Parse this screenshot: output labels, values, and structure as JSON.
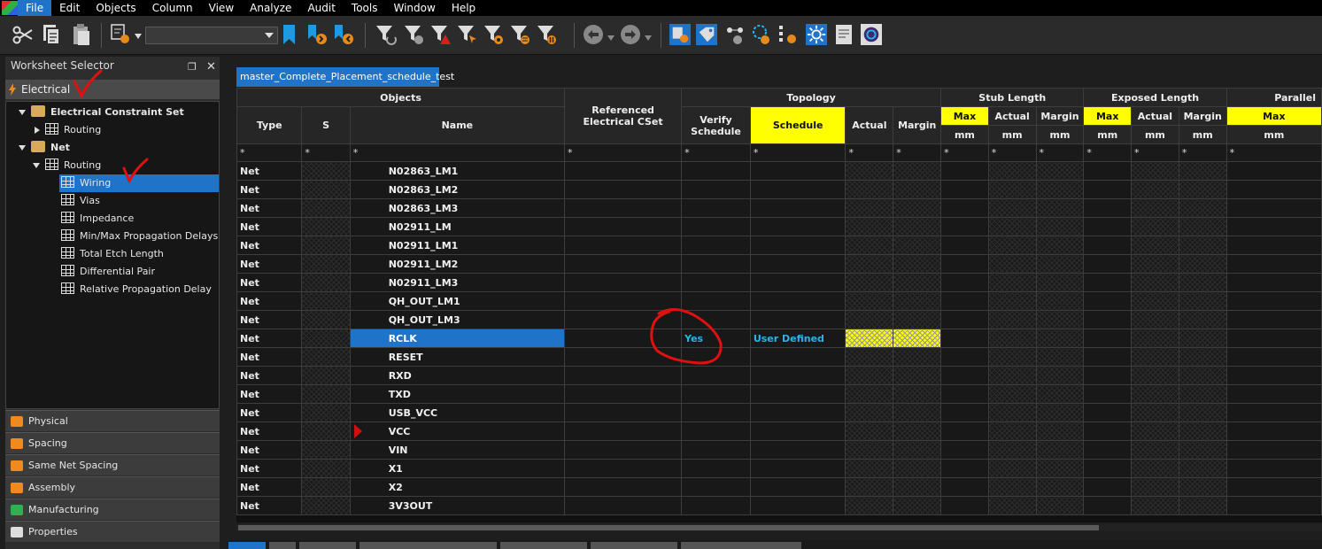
{
  "menubar": {
    "items": [
      "File",
      "Edit",
      "Objects",
      "Column",
      "View",
      "Analyze",
      "Audit",
      "Tools",
      "Window",
      "Help"
    ],
    "active_index": 0
  },
  "toolbar": {
    "combo_value": "",
    "icons": [
      "cut-icon",
      "copy-icon",
      "paste-icon",
      "find-icon",
      "bookmark-icon",
      "bookmark-next-icon",
      "bookmark-prev-icon",
      "filter-icon",
      "filter-clear-icon",
      "filter-error-icon",
      "filter-select-icon",
      "filter-settings-icon",
      "filter-list-icon",
      "filter-pause-icon",
      "undo-icon",
      "redo-icon",
      "sheet-icon",
      "tag-icon",
      "net-icon",
      "loop-icon",
      "group-icon",
      "settings-sun-icon",
      "report-icon",
      "search-icon"
    ]
  },
  "worksheet_selector": {
    "title": "Worksheet Selector",
    "category": "Electrical",
    "tree": [
      {
        "label": "Electrical Constraint Set",
        "level": 0,
        "kind": "folder",
        "expanded": true
      },
      {
        "label": "Routing",
        "level": 1,
        "kind": "sheet",
        "expanded": false
      },
      {
        "label": "Net",
        "level": 0,
        "kind": "folder",
        "expanded": true
      },
      {
        "label": "Routing",
        "level": 1,
        "kind": "sheet",
        "expanded": true
      },
      {
        "label": "Wiring",
        "level": 2,
        "kind": "sheet",
        "selected": true
      },
      {
        "label": "Vias",
        "level": 2,
        "kind": "sheet"
      },
      {
        "label": "Impedance",
        "level": 2,
        "kind": "sheet"
      },
      {
        "label": "Min/Max Propagation Delays",
        "level": 2,
        "kind": "sheet"
      },
      {
        "label": "Total Etch Length",
        "level": 2,
        "kind": "sheet"
      },
      {
        "label": "Differential Pair",
        "level": 2,
        "kind": "sheet"
      },
      {
        "label": "Relative Propagation Delay",
        "level": 2,
        "kind": "sheet"
      }
    ],
    "categories": [
      "Physical",
      "Spacing",
      "Same Net Spacing",
      "Assembly",
      "Manufacturing",
      "Properties"
    ]
  },
  "worksheet": {
    "tab": "master_Complete_Placement_schedule_test",
    "groups": {
      "objects": "Objects",
      "ref_cset": "Referenced Electrical CSet",
      "topology": "Topology",
      "stub_length": "Stub Length",
      "exposed_length": "Exposed Length",
      "parallel": "Parallel"
    },
    "columns": {
      "type": "Type",
      "s": "S",
      "name": "Name",
      "verify_schedule": "Verify Schedule",
      "schedule": "Schedule",
      "actual": "Actual",
      "margin": "Margin",
      "max": "Max",
      "unit": "mm"
    },
    "filter": "*",
    "rows": [
      {
        "type": "Net",
        "name": "N02863_LM1"
      },
      {
        "type": "Net",
        "name": "N02863_LM2"
      },
      {
        "type": "Net",
        "name": "N02863_LM3"
      },
      {
        "type": "Net",
        "name": "N02911_LM"
      },
      {
        "type": "Net",
        "name": "N02911_LM1"
      },
      {
        "type": "Net",
        "name": "N02911_LM2"
      },
      {
        "type": "Net",
        "name": "N02911_LM3"
      },
      {
        "type": "Net",
        "name": "QH_OUT_LM1"
      },
      {
        "type": "Net",
        "name": "QH_OUT_LM3"
      },
      {
        "type": "Net",
        "name": "RCLK",
        "selected": true,
        "verify_schedule": "Yes",
        "schedule": "User Defined"
      },
      {
        "type": "Net",
        "name": "RESET"
      },
      {
        "type": "Net",
        "name": "RXD"
      },
      {
        "type": "Net",
        "name": "TXD"
      },
      {
        "type": "Net",
        "name": "USB_VCC"
      },
      {
        "type": "Net",
        "name": "VCC",
        "flag": true
      },
      {
        "type": "Net",
        "name": "VIN"
      },
      {
        "type": "Net",
        "name": "X1"
      },
      {
        "type": "Net",
        "name": "X2"
      },
      {
        "type": "Net",
        "name": "3V3OUT"
      }
    ]
  },
  "colors": {
    "accent": "#1f73c8",
    "highlight_yellow": "#ffff00",
    "cyan_text": "#2ab4e8",
    "annotation_red": "#e01010"
  }
}
